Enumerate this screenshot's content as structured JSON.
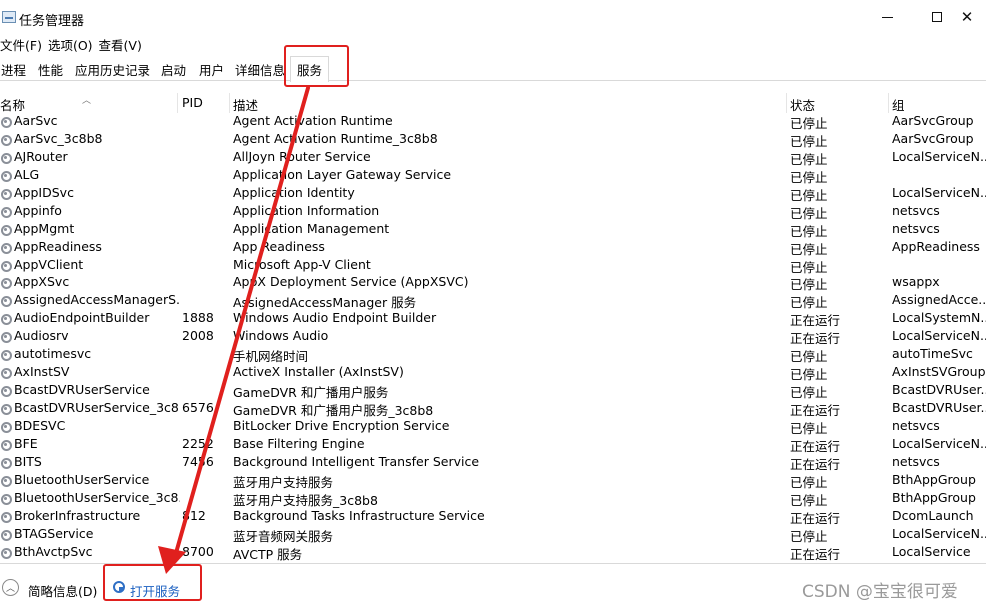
{
  "window": {
    "title": "任务管理器",
    "icon": "task-manager-icon",
    "controls": {
      "minimize": "minimize-icon",
      "maximize": "maximize-icon",
      "close": "✕"
    }
  },
  "menu": [
    "文件(F)",
    "选项(O)",
    "查看(V)"
  ],
  "tabs": [
    {
      "label": "进程"
    },
    {
      "label": "性能"
    },
    {
      "label": "应用历史记录"
    },
    {
      "label": "启动"
    },
    {
      "label": "用户"
    },
    {
      "label": "详细信息"
    },
    {
      "label": "服务",
      "active": true
    }
  ],
  "columns": {
    "name": "名称",
    "pid": "PID",
    "desc": "描述",
    "status": "状态",
    "group": "组"
  },
  "services": [
    {
      "name": "AarSvc",
      "pid": "",
      "desc": "Agent Activation Runtime",
      "status": "已停止",
      "group": "AarSvcGroup"
    },
    {
      "name": "AarSvc_3c8b8",
      "pid": "",
      "desc": "Agent Activation Runtime_3c8b8",
      "status": "已停止",
      "group": "AarSvcGroup"
    },
    {
      "name": "AJRouter",
      "pid": "",
      "desc": "AllJoyn Router Service",
      "status": "已停止",
      "group": "LocalServiceN..."
    },
    {
      "name": "ALG",
      "pid": "",
      "desc": "Application Layer Gateway Service",
      "status": "已停止",
      "group": ""
    },
    {
      "name": "AppIDSvc",
      "pid": "",
      "desc": "Application Identity",
      "status": "已停止",
      "group": "LocalServiceN..."
    },
    {
      "name": "Appinfo",
      "pid": "",
      "desc": "Application Information",
      "status": "已停止",
      "group": "netsvcs"
    },
    {
      "name": "AppMgmt",
      "pid": "",
      "desc": "Application Management",
      "status": "已停止",
      "group": "netsvcs"
    },
    {
      "name": "AppReadiness",
      "pid": "",
      "desc": "App Readiness",
      "status": "已停止",
      "group": "AppReadiness"
    },
    {
      "name": "AppVClient",
      "pid": "",
      "desc": "Microsoft App-V Client",
      "status": "已停止",
      "group": ""
    },
    {
      "name": "AppXSvc",
      "pid": "",
      "desc": "AppX Deployment Service (AppXSVC)",
      "status": "已停止",
      "group": "wsappx"
    },
    {
      "name": "AssignedAccessManagerS...",
      "pid": "",
      "desc": "AssignedAccessManager 服务",
      "status": "已停止",
      "group": "AssignedAcce..."
    },
    {
      "name": "AudioEndpointBuilder",
      "pid": "1888",
      "desc": "Windows Audio Endpoint Builder",
      "status": "正在运行",
      "group": "LocalSystemN..."
    },
    {
      "name": "Audiosrv",
      "pid": "2008",
      "desc": "Windows Audio",
      "status": "正在运行",
      "group": "LocalServiceN..."
    },
    {
      "name": "autotimesvc",
      "pid": "",
      "desc": "手机网络时间",
      "status": "已停止",
      "group": "autoTimeSvc"
    },
    {
      "name": "AxInstSV",
      "pid": "",
      "desc": "ActiveX Installer (AxInstSV)",
      "status": "已停止",
      "group": "AxInstSVGroup"
    },
    {
      "name": "BcastDVRUserService",
      "pid": "",
      "desc": "GameDVR 和广播用户服务",
      "status": "已停止",
      "group": "BcastDVRUser..."
    },
    {
      "name": "BcastDVRUserService_3c8...",
      "pid": "6576",
      "desc": "GameDVR 和广播用户服务_3c8b8",
      "status": "正在运行",
      "group": "BcastDVRUser..."
    },
    {
      "name": "BDESVC",
      "pid": "",
      "desc": "BitLocker Drive Encryption Service",
      "status": "已停止",
      "group": "netsvcs"
    },
    {
      "name": "BFE",
      "pid": "2252",
      "desc": "Base Filtering Engine",
      "status": "正在运行",
      "group": "LocalServiceN..."
    },
    {
      "name": "BITS",
      "pid": "7456",
      "desc": "Background Intelligent Transfer Service",
      "status": "正在运行",
      "group": "netsvcs"
    },
    {
      "name": "BluetoothUserService",
      "pid": "",
      "desc": "蓝牙用户支持服务",
      "status": "已停止",
      "group": "BthAppGroup"
    },
    {
      "name": "BluetoothUserService_3c8...",
      "pid": "",
      "desc": "蓝牙用户支持服务_3c8b8",
      "status": "已停止",
      "group": "BthAppGroup"
    },
    {
      "name": "BrokerInfrastructure",
      "pid": "812",
      "desc": "Background Tasks Infrastructure Service",
      "status": "正在运行",
      "group": "DcomLaunch"
    },
    {
      "name": "BTAGService",
      "pid": "",
      "desc": "蓝牙音频网关服务",
      "status": "已停止",
      "group": "LocalServiceN..."
    },
    {
      "name": "BthAvctpSvc",
      "pid": "8700",
      "desc": "AVCTP 服务",
      "status": "正在运行",
      "group": "LocalService"
    }
  ],
  "footer": {
    "summary": "简略信息(D)",
    "open_services": "打开服务"
  },
  "watermark": "CSDN @宝宝很可爱",
  "colors": {
    "annotation": "#e0201e",
    "link": "#1a5fc0"
  }
}
